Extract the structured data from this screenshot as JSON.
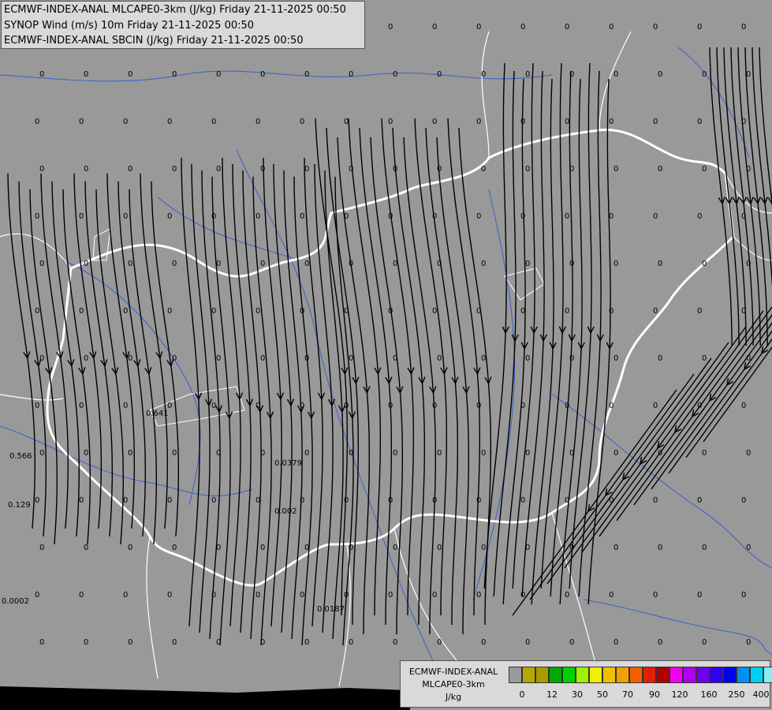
{
  "titles": [
    "ECMWF-INDEX-ANAL MLCAPE0-3km (J/kg) Friday 21-11-2025 00:50",
    "SYNOP Wind (m/s) 10m Friday 21-11-2025 00:50",
    "ECMWF-INDEX-ANAL SBCIN (J/kg) Friday 21-11-2025 00:50"
  ],
  "legend": {
    "line1": "ECMWF-INDEX-ANAL",
    "line2": "MLCAPE0-3km",
    "unit": "J/kg",
    "colors": [
      "#9a9a9a",
      "#b4a800",
      "#a89a00",
      "#00a800",
      "#00d000",
      "#a0f000",
      "#f0f000",
      "#f0c000",
      "#f0a000",
      "#f06000",
      "#e02000",
      "#b00000",
      "#f000f0",
      "#b000f0",
      "#7000f0",
      "#3000f0",
      "#0000f0",
      "#0090f0",
      "#00d0f0",
      "#80f0f0",
      "#f4f4f4"
    ],
    "ticks": [
      "0",
      "12",
      "30",
      "50",
      "70",
      "90",
      "120",
      "160",
      "250",
      "400"
    ]
  },
  "colors": {
    "background": "#999999",
    "border": "#ffffff",
    "river": "#3a5fcd",
    "streamline": "#000000"
  },
  "map_values": [
    "0",
    "0",
    "0",
    "0",
    "0",
    "0",
    "0",
    "0",
    "0",
    "0",
    "0",
    "0",
    "0",
    "0",
    "0",
    "0",
    "0",
    "0",
    "0.641",
    "0.566",
    "0.0379",
    "0.002",
    "0.0002",
    "0.0187",
    "0.129"
  ]
}
